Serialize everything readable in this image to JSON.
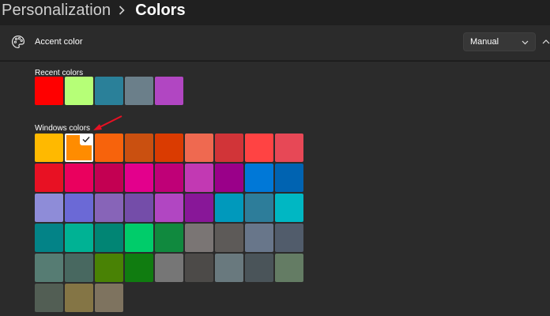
{
  "breadcrumb": {
    "parent": "Personalization",
    "separator_icon": "chevron-right-icon",
    "current": "Colors"
  },
  "accent_color": {
    "icon": "palette-icon",
    "label": "Accent color",
    "mode_selected": "Manual",
    "dropdown_icon": "chevron-down-icon",
    "collapse_icon": "chevron-up-icon"
  },
  "recent_colors": {
    "label": "Recent colors",
    "swatches": [
      "#ff0000",
      "#b6ff77",
      "#2a8099",
      "#6b7f8a",
      "#b146c2"
    ]
  },
  "windows_colors": {
    "label": "Windows colors",
    "selected_color": "#ff8c00",
    "selected_indicator": "checkmark-icon",
    "rows": [
      [
        "#ffb900",
        "#ff8c00",
        "#f7630c",
        "#ca5010",
        "#da3b01",
        "#ef6950",
        "#d13438",
        "#ff4343",
        "#e74856"
      ],
      [
        "#e81123",
        "#ea005e",
        "#c30052",
        "#e3008c",
        "#bf0077",
        "#c239b3",
        "#9a0089",
        "#0078d7",
        "#0063b1"
      ],
      [
        "#8e8cd8",
        "#6b69d6",
        "#8764b8",
        "#744da9",
        "#b146c2",
        "#881798",
        "#0099bc",
        "#2d7d9a",
        "#00b7c3"
      ],
      [
        "#038387",
        "#00b294",
        "#018574",
        "#00cc6a",
        "#10893e",
        "#7a7574",
        "#5d5a58",
        "#68768a",
        "#515c6b"
      ],
      [
        "#567c73",
        "#486860",
        "#498205",
        "#107c10",
        "#767676",
        "#4c4a48",
        "#69797e",
        "#4a5459",
        "#647c64"
      ],
      [
        "#525e54",
        "#847545",
        "#7e735f"
      ]
    ]
  },
  "annotation": {
    "type": "arrow",
    "color": "#e81123"
  }
}
